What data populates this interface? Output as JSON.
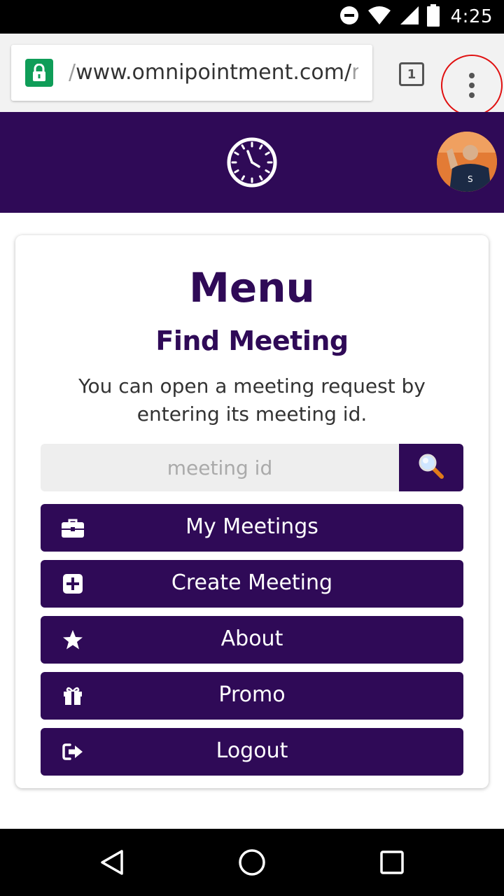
{
  "status_bar": {
    "time": "4:25",
    "icons": [
      "do-not-disturb-icon",
      "wifi-icon",
      "cell-signal-icon",
      "battery-icon"
    ]
  },
  "browser": {
    "url_lead": "/",
    "url_main": "www.omnipointment.com/",
    "url_tail": "r",
    "tab_count": "1",
    "icons": [
      "lock-icon",
      "tab-switcher-icon",
      "overflow-menu-icon"
    ]
  },
  "app_header": {
    "icons": [
      "clock-logo-icon",
      "user-avatar"
    ]
  },
  "card": {
    "title": "Menu",
    "subtitle": "Find Meeting",
    "description": "You can open a meeting request by entering its meeting id.",
    "search": {
      "placeholder": "meeting id",
      "value": "",
      "button_icon": "search-icon"
    },
    "buttons": [
      {
        "label": "My Meetings",
        "icon": "briefcase-icon"
      },
      {
        "label": "Create Meeting",
        "icon": "plus-square-icon"
      },
      {
        "label": "About",
        "icon": "star-icon"
      },
      {
        "label": "Promo",
        "icon": "gift-icon"
      },
      {
        "label": "Logout",
        "icon": "sign-out-icon"
      }
    ]
  },
  "nav_bar": {
    "icons": [
      "back-icon",
      "home-icon",
      "recents-icon"
    ]
  },
  "colors": {
    "brand_purple": "#2f0a57",
    "lock_green": "#0f9d58",
    "highlight_red": "#e01010"
  }
}
